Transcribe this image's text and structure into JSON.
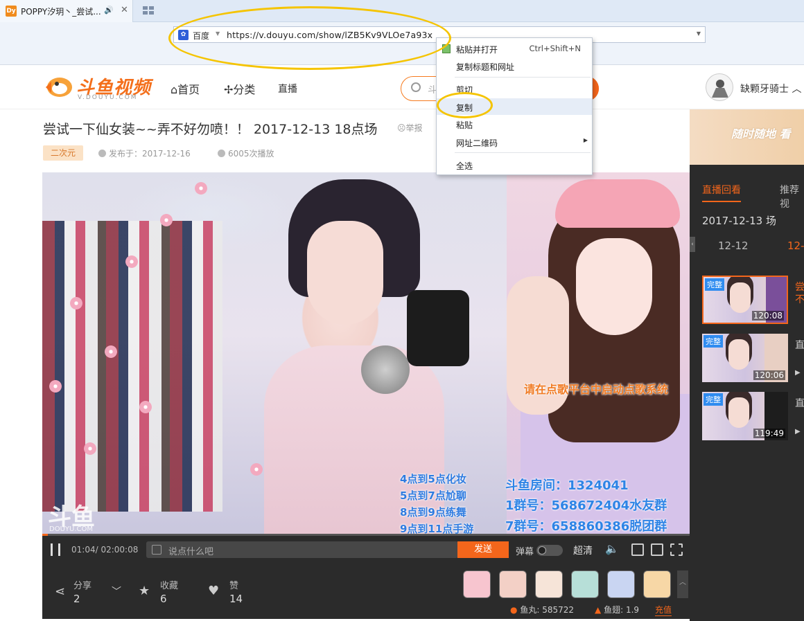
{
  "browser": {
    "tab_title": "POPPY汐玥丶_尝试...",
    "tab_logo_text": "Dy",
    "search_engine": "百度",
    "url": "https://v.douyu.com/show/lZB5Kv9VLOe7a93x"
  },
  "context_menu": {
    "items": [
      {
        "label": "粘贴并打开",
        "shortcut": "Ctrl+Shift+N"
      },
      {
        "label": "复制标题和网址"
      },
      {
        "label": "剪切"
      },
      {
        "label": "复制"
      },
      {
        "label": "粘贴"
      },
      {
        "label": "网址二维码"
      },
      {
        "label": "全选"
      }
    ]
  },
  "site": {
    "logo_text": "斗鱼视频",
    "logo_sub": "V.DOUYU.COM",
    "nav": [
      "首页",
      "分类",
      "直播"
    ],
    "search_placeholder": "斗",
    "username": "缺颗牙骑士"
  },
  "video": {
    "title": "尝试一下仙女装~~弄不好勿喷！！ 2017-12-13 18点场",
    "report_label": "举报",
    "tag": "二次元",
    "publish": "发布于：2017-12-16",
    "plays": "6005次播放",
    "overlay_request": "请在点歌平台中启动点歌系统",
    "schedule": [
      "4点到5点化妆",
      "5点到7点尬聊",
      "8点到9点练舞",
      "9点到11点手游"
    ],
    "room_line": "斗鱼房间：1324041",
    "group1_line": "1群号：568672404水友群",
    "group7_line": "7群号：658860386脱团群",
    "watermark": "斗鱼",
    "watermark_sub": "DOUYU.COM",
    "progress": 0.0087
  },
  "player": {
    "time": "01:04/ 02:00:08",
    "danmu_placeholder": "说点什么吧",
    "send_label": "发送",
    "danmu_toggle_label": "弹幕",
    "quality": "超清"
  },
  "stats": {
    "share_label": "分享",
    "share_count": "2",
    "fav_label": "收藏",
    "fav_count": "6",
    "like_label": "赞",
    "like_count": "14"
  },
  "balance": {
    "fish_label": "鱼丸:",
    "fish_value": "585722",
    "chi_label": "鱼翅:",
    "chi_value": "1.9",
    "recharge_label": "充值"
  },
  "side": {
    "banner": "随时随地 看",
    "tab_replay": "直播回看",
    "tab_recommend": "推荐视",
    "date_title": "2017-12-13 场",
    "date_a": "12-12",
    "date_b": "12-",
    "videos": [
      {
        "badge": "完整",
        "duration": "120:08",
        "title_lines": [
          "尝",
          "不"
        ]
      },
      {
        "badge": "完整",
        "duration": "120:06",
        "title_lines": [
          "直",
          ""
        ]
      },
      {
        "badge": "完整",
        "duration": "119:49",
        "title_lines": [
          "直",
          ""
        ]
      }
    ]
  },
  "colors": {
    "accent": "#f4661b",
    "highlight_circle": "#f5c400",
    "link_blue": "#2f8cf0"
  }
}
